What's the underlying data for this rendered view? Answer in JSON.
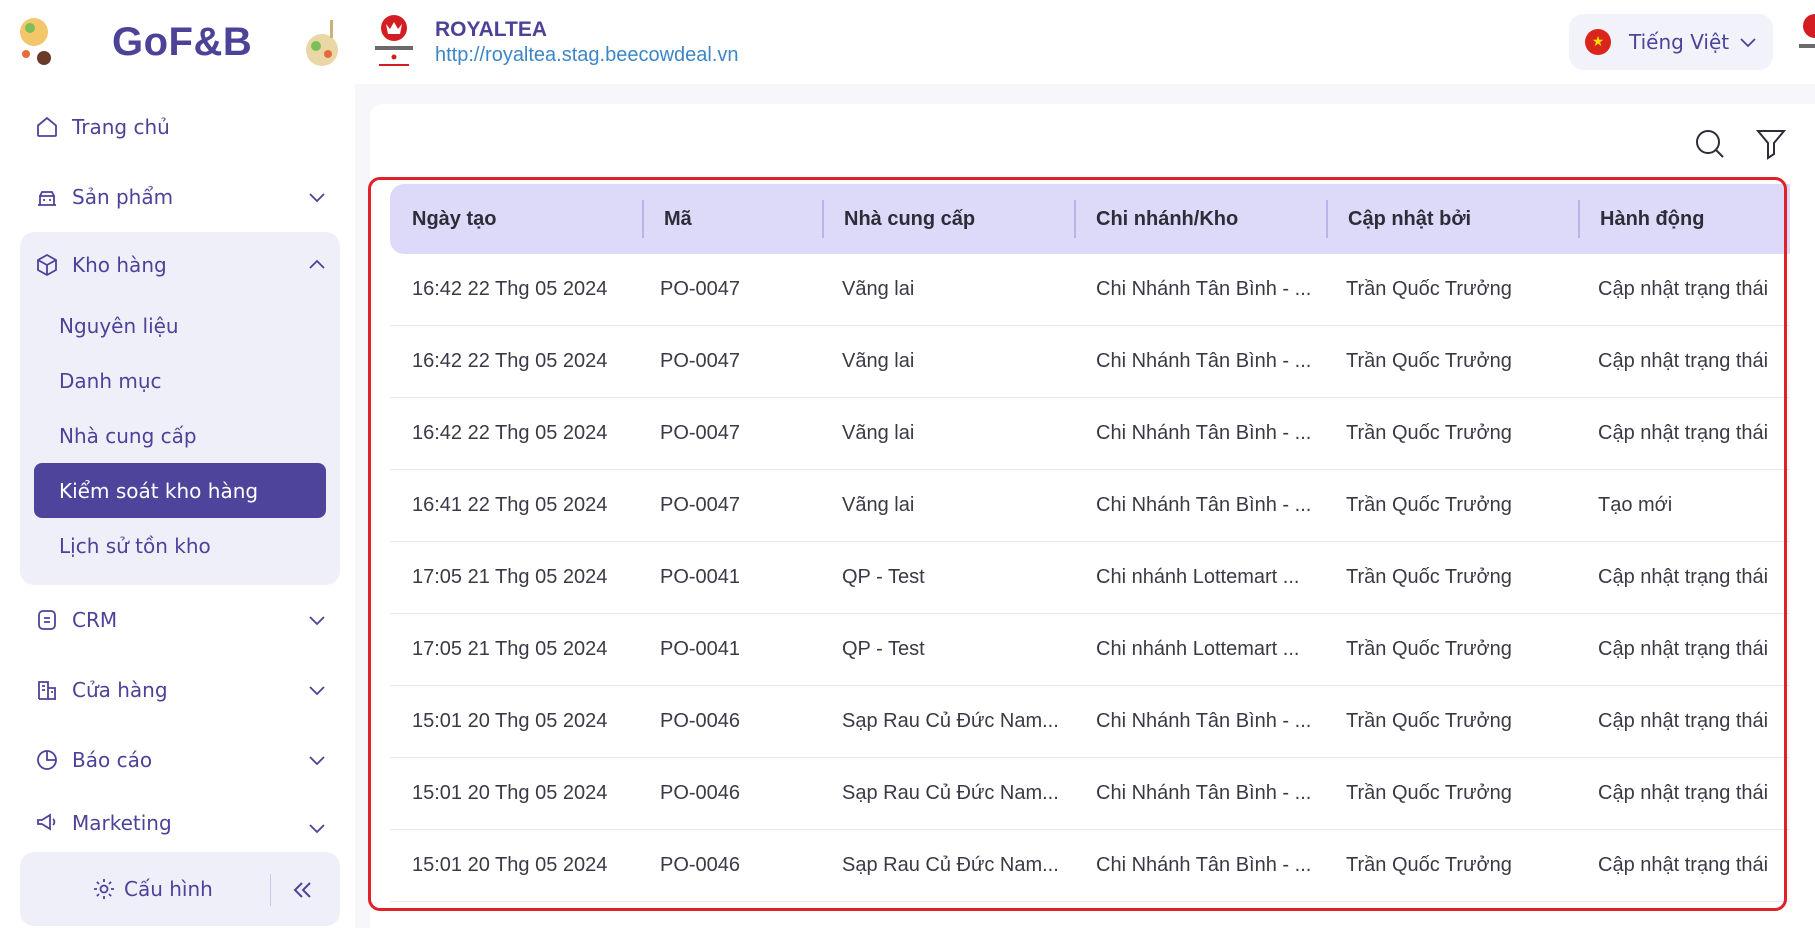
{
  "sidebar": {
    "logo": "GoF&B",
    "nav": {
      "home": "Trang chủ",
      "products": "Sản phẩm",
      "warehouse": "Kho hàng",
      "warehouse_items": [
        "Nguyên liệu",
        "Danh mục",
        "Nhà cung cấp",
        "Kiểm soát kho hàng",
        "Lịch sử tồn kho"
      ],
      "crm": "CRM",
      "stores": "Cửa hàng",
      "reports": "Báo cáo",
      "marketing": "Marketing"
    },
    "config_label": "Cấu hình"
  },
  "header": {
    "brand_name": "ROYALTEA",
    "brand_url": "http://royaltea.stag.beecowdeal.vn",
    "language": "Tiếng Việt"
  },
  "table": {
    "columns": [
      "Ngày tạo",
      "Mã",
      "Nhà cung cấp",
      "Chi nhánh/Kho",
      "Cập nhật bởi",
      "Hành động"
    ],
    "rows": [
      [
        "16:42 22 Thg 05 2024",
        "PO-0047",
        "Vãng lai",
        "Chi Nhánh Tân Bình - ...",
        "Trần Quốc Trưởng",
        "Cập nhật trạng thái"
      ],
      [
        "16:42 22 Thg 05 2024",
        "PO-0047",
        "Vãng lai",
        "Chi Nhánh Tân Bình - ...",
        "Trần Quốc Trưởng",
        "Cập nhật trạng thái"
      ],
      [
        "16:42 22 Thg 05 2024",
        "PO-0047",
        "Vãng lai",
        "Chi Nhánh Tân Bình - ...",
        "Trần Quốc Trưởng",
        "Cập nhật trạng thái"
      ],
      [
        "16:41 22 Thg 05 2024",
        "PO-0047",
        "Vãng lai",
        "Chi Nhánh Tân Bình - ...",
        "Trần Quốc Trưởng",
        "Tạo mới"
      ],
      [
        "17:05 21 Thg 05 2024",
        "PO-0041",
        "QP - Test",
        "Chi nhánh Lottemart ...",
        "Trần Quốc Trưởng",
        "Cập nhật trạng thái"
      ],
      [
        "17:05 21 Thg 05 2024",
        "PO-0041",
        "QP - Test",
        "Chi nhánh Lottemart ...",
        "Trần Quốc Trưởng",
        "Cập nhật trạng thái"
      ],
      [
        "15:01 20 Thg 05 2024",
        "PO-0046",
        "Sạp Rau Củ Đức Nam...",
        "Chi Nhánh Tân Bình - ...",
        "Trần Quốc Trưởng",
        "Cập nhật trạng thái"
      ],
      [
        "15:01 20 Thg 05 2024",
        "PO-0046",
        "Sạp Rau Củ Đức Nam...",
        "Chi Nhánh Tân Bình - ...",
        "Trần Quốc Trưởng",
        "Cập nhật trạng thái"
      ],
      [
        "15:01 20 Thg 05 2024",
        "PO-0046",
        "Sạp Rau Củ Đức Nam...",
        "Chi Nhánh Tân Bình - ...",
        "Trần Quốc Trưởng",
        "Cập nhật trạng thái"
      ]
    ]
  },
  "colors": {
    "brand": "#4c4399",
    "active": "#4e449c",
    "header_row": "#dcdaf8",
    "highlight": "#e0202a",
    "link": "#3d86c6"
  },
  "icons": [
    "home-icon",
    "products-icon",
    "box-icon",
    "crm-icon",
    "store-icon",
    "report-icon",
    "megaphone-icon",
    "gear-icon",
    "collapse-icon",
    "search-icon",
    "filter-icon",
    "chevron-down-icon",
    "chevron-up-icon",
    "vietnam-flag-icon"
  ]
}
